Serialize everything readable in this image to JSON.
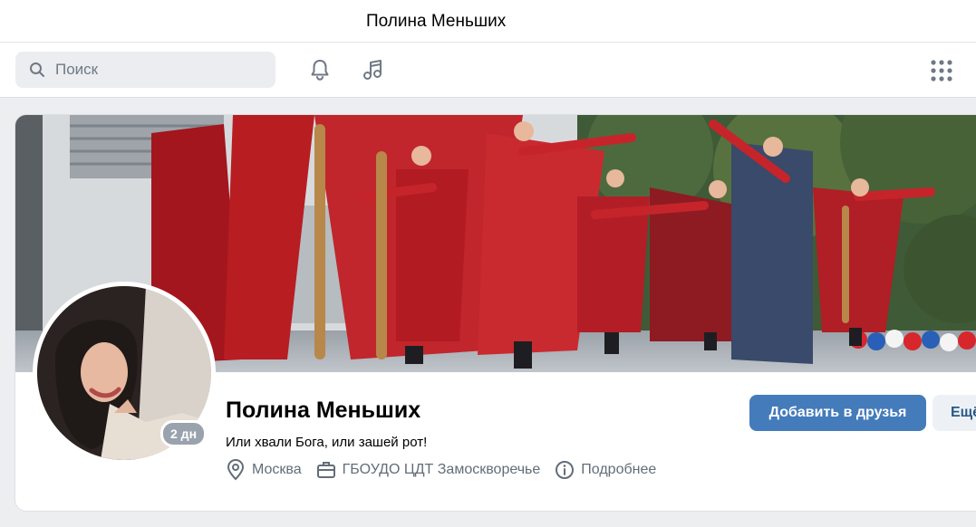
{
  "window": {
    "title": "Полина Меньших"
  },
  "header": {
    "search_placeholder": "Поиск",
    "icons": [
      "search-icon",
      "bell-icon",
      "music-icon",
      "apps-grid-icon"
    ]
  },
  "profile": {
    "name": "Полина Меньших",
    "status": "Или хвали Бога, или зашей рот!",
    "last_seen_badge": "2 дн",
    "info": [
      {
        "icon": "location-icon",
        "label": "Москва"
      },
      {
        "icon": "briefcase-icon",
        "label": "ГБОУДО ЦДТ Замоскворечье"
      },
      {
        "icon": "info-icon",
        "label": "Подробнее"
      }
    ],
    "add_friend_label": "Добавить в друзья",
    "more_label": "Ещё"
  },
  "colors": {
    "accent": "#447bba",
    "secondary_button_bg": "#edf1f6",
    "badge": "#99a2ad",
    "page_bg": "#edeef0"
  }
}
